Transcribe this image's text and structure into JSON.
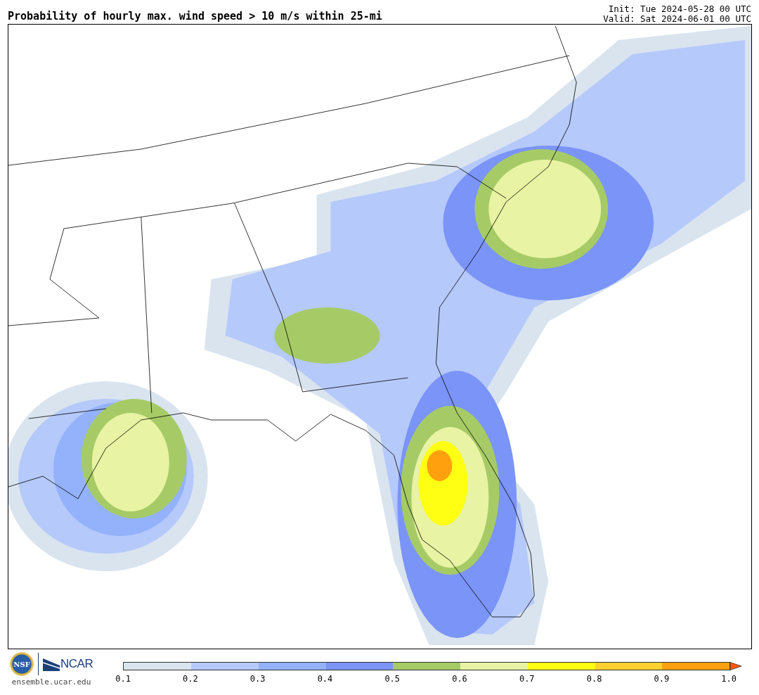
{
  "header": {
    "title": "Probability of hourly max. wind speed > 10 m/s within 25-mi",
    "init": "Init: Tue 2024-05-28 00 UTC",
    "valid": "Valid: Sat 2024-06-01 00 UTC"
  },
  "footer": {
    "logos": [
      {
        "text": "NSF"
      },
      {
        "text": "NCAR"
      }
    ],
    "site": "ensemble.ucar.edu"
  },
  "colorbar": {
    "bins": [
      {
        "color": "#d9e4ef"
      },
      {
        "color": "#b5c9fa"
      },
      {
        "color": "#93b2fb"
      },
      {
        "color": "#7b94f8"
      },
      {
        "color": "#a6cb66"
      },
      {
        "color": "#e8f3a3"
      },
      {
        "color": "#ffff14"
      },
      {
        "color": "#ffd02e"
      },
      {
        "color": "#ffa10f"
      }
    ],
    "extend": {
      "color": "#ff5a0f"
    },
    "ticks": [
      "0.1",
      "0.2",
      "0.3",
      "0.4",
      "0.5",
      "0.6",
      "0.7",
      "0.8",
      "0.9",
      "1.0"
    ]
  }
}
